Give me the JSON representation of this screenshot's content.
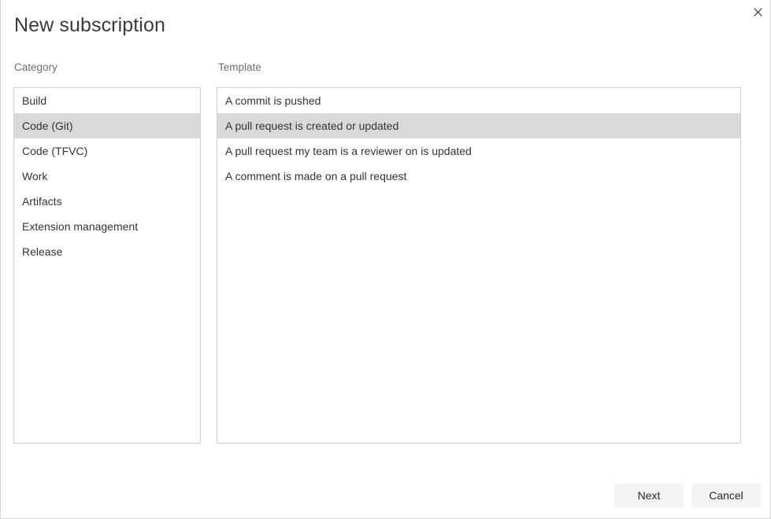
{
  "dialog": {
    "title": "New subscription",
    "close_icon": "close-icon"
  },
  "category": {
    "label": "Category",
    "items": [
      {
        "label": "Build",
        "selected": false
      },
      {
        "label": "Code (Git)",
        "selected": true
      },
      {
        "label": "Code (TFVC)",
        "selected": false
      },
      {
        "label": "Work",
        "selected": false
      },
      {
        "label": "Artifacts",
        "selected": false
      },
      {
        "label": "Extension management",
        "selected": false
      },
      {
        "label": "Release",
        "selected": false
      }
    ]
  },
  "template": {
    "label": "Template",
    "items": [
      {
        "label": "A commit is pushed",
        "selected": false
      },
      {
        "label": "A pull request is created or updated",
        "selected": true
      },
      {
        "label": "A pull request my team is a reviewer on is updated",
        "selected": false
      },
      {
        "label": "A comment is made on a pull request",
        "selected": false
      }
    ]
  },
  "footer": {
    "next_label": "Next",
    "cancel_label": "Cancel"
  },
  "colors": {
    "selection": "#d9d9d9",
    "border": "#cfcfcf",
    "button_bg": "#f4f4f4",
    "text": "#333333",
    "label_text": "#6e6e6e",
    "title_text": "#3b3b3b"
  }
}
